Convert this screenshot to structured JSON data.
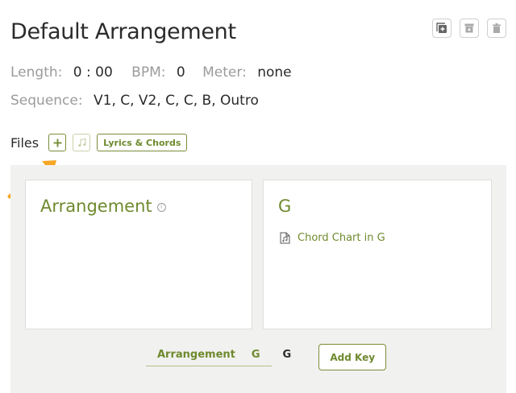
{
  "arrangement": {
    "title": "Default Arrangement",
    "length_label": "Length:",
    "length_value": "0 : 00",
    "bpm_label": "BPM:",
    "bpm_value": "0",
    "meter_label": "Meter:",
    "meter_value": "none",
    "sequence_label": "Sequence:",
    "sequence_value": "V1, C, V2, C, C, B, Outro"
  },
  "top_actions": {
    "icons": [
      "duplicate-icon",
      "archive-icon",
      "trash-icon"
    ]
  },
  "files": {
    "label": "Files",
    "add_icon": "plus-icon",
    "music_icon": "music-note-icon",
    "lyrics_chords_label": "Lyrics & Chords"
  },
  "cards": {
    "arrangement_title": "Arrangement",
    "key_title": "G",
    "file_name": "Chord Chart in G",
    "file_icon": "music-file-icon"
  },
  "bottom": {
    "tab_arrangement": "Arrangement",
    "tab_key": "G",
    "current_key": "G",
    "add_key_label": "Add Key"
  },
  "colors": {
    "accent": "#6f8a2e",
    "arrow": "#f5a623",
    "panel_bg": "#f1f1ef"
  }
}
